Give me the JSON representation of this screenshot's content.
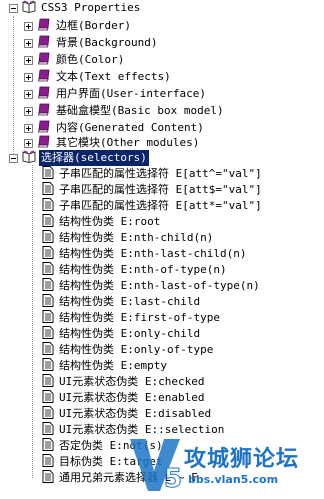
{
  "tree": {
    "root": {
      "label": "CSS3 Properties"
    },
    "categories": [
      {
        "label": "边框(Border)"
      },
      {
        "label": "背景(Background)"
      },
      {
        "label": "颜色(Color)"
      },
      {
        "label": "文本(Text effects)"
      },
      {
        "label": "用户界面(User-interface)"
      },
      {
        "label": "基础盒模型(Basic box model)"
      },
      {
        "label": "内容(Generated Content)"
      },
      {
        "label": "其它模块(Other modules)"
      }
    ],
    "selectors": {
      "label": "选择器(selectors)",
      "items": [
        {
          "label": "子串匹配的属性选择符 E[att^=\"val\"]"
        },
        {
          "label": "子串匹配的属性选择符 E[att$=\"val\"]"
        },
        {
          "label": "子串匹配的属性选择符 E[att*=\"val\"]"
        },
        {
          "label": "结构性伪类 E:root"
        },
        {
          "label": "结构性伪类 E:nth-child(n)"
        },
        {
          "label": "结构性伪类 E:nth-last-child(n)"
        },
        {
          "label": "结构性伪类 E:nth-of-type(n)"
        },
        {
          "label": "结构性伪类 E:nth-last-of-type(n)"
        },
        {
          "label": "结构性伪类 E:last-child"
        },
        {
          "label": "结构性伪类 E:first-of-type"
        },
        {
          "label": "结构性伪类 E:only-child"
        },
        {
          "label": "结构性伪类 E:only-of-type"
        },
        {
          "label": "结构性伪类 E:empty"
        },
        {
          "label": "UI元素状态伪类 E:checked"
        },
        {
          "label": "UI元素状态伪类 E:enabled"
        },
        {
          "label": "UI元素状态伪类 E:disabled"
        },
        {
          "label": "UI元素状态伪类 E::selection"
        },
        {
          "label": "否定伪类 E:not(s)"
        },
        {
          "label": "目标伪类 E:target"
        },
        {
          "label": "通用兄弟元素选择器 E ~ F"
        }
      ]
    }
  },
  "watermark": {
    "title": "攻城狮论坛",
    "url": "bbs.vlan5.com",
    "logo_text": "V5"
  },
  "colors": {
    "selection": "#0a246a",
    "book": "#8b1c8f",
    "watermark": "#1d74c7"
  },
  "icons": {
    "root": "open-book-icon",
    "category": "closed-book-icon",
    "page": "document-page-icon"
  }
}
